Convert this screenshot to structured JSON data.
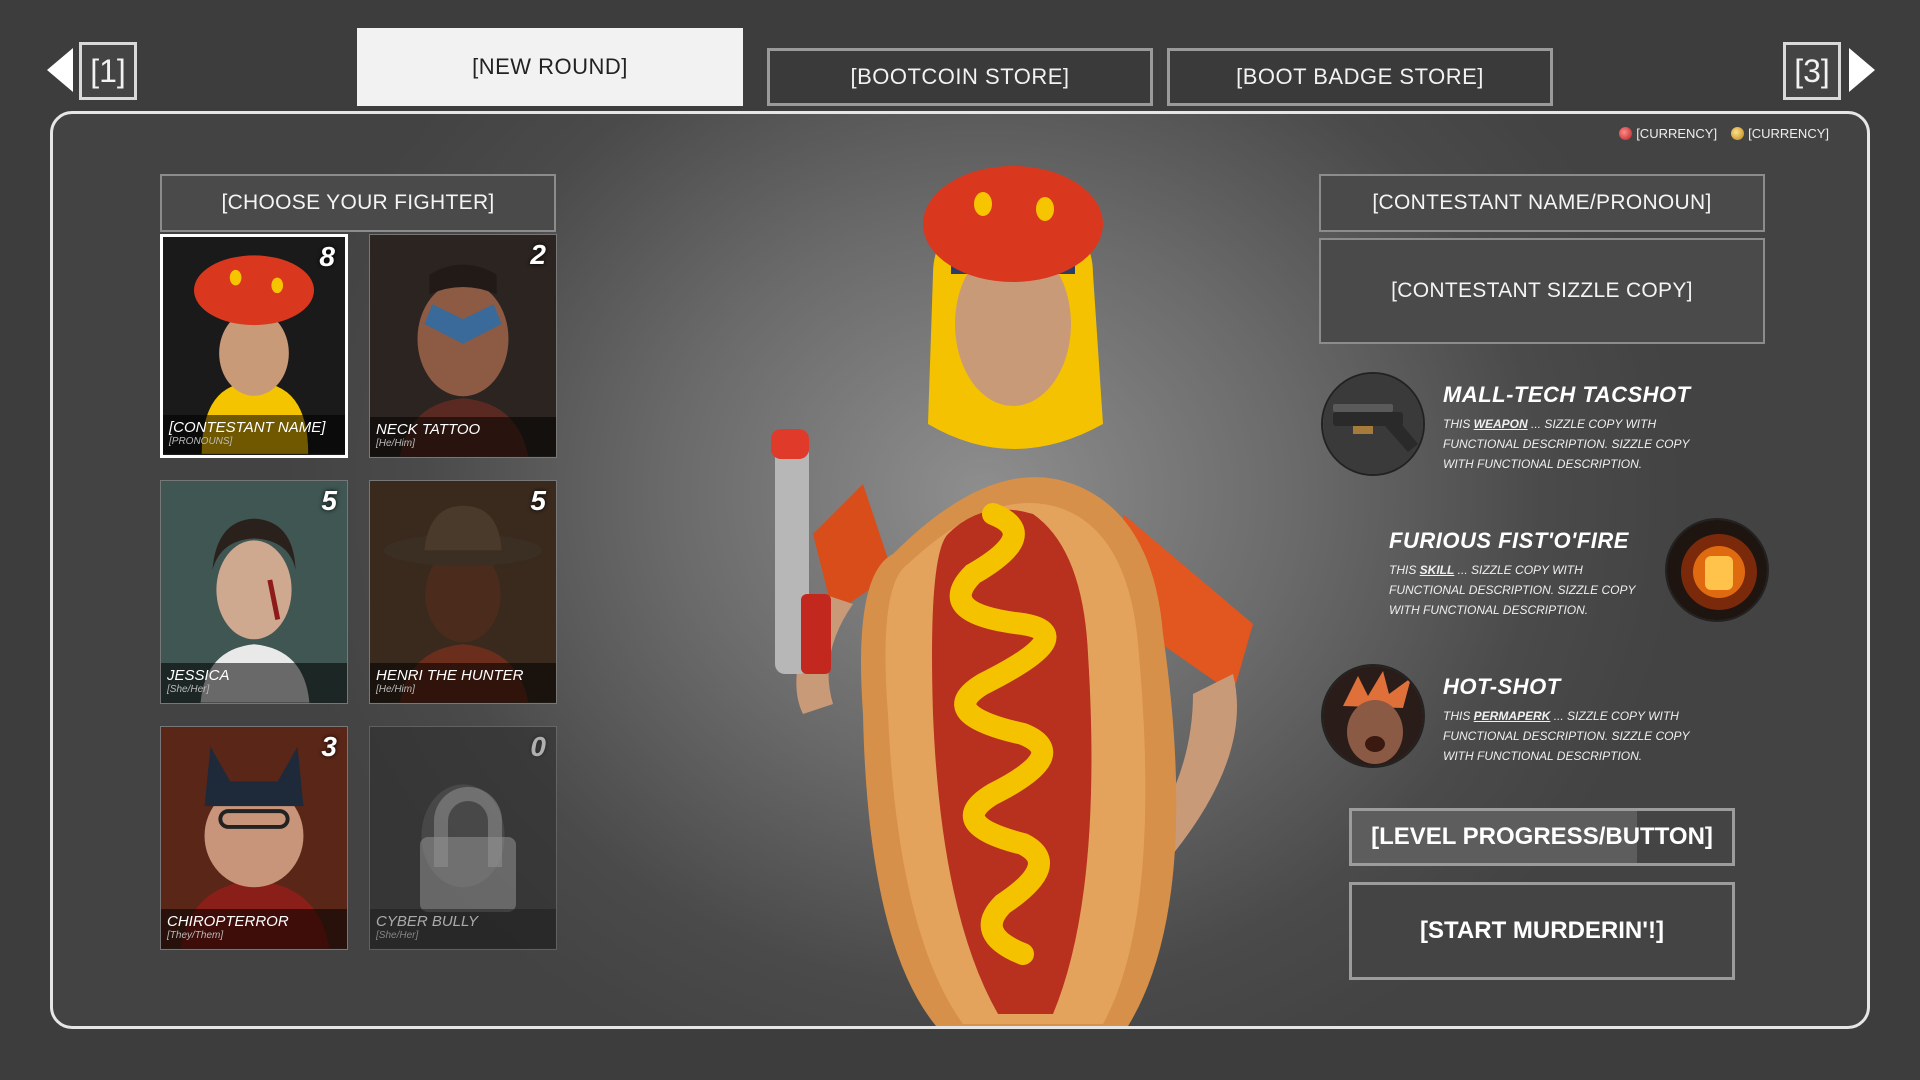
{
  "nav": {
    "prev_page": "[1]",
    "next_page": "[3]",
    "tabs": [
      {
        "label": "[NEW ROUND]",
        "active": true
      },
      {
        "label": "[BOOTCOIN STORE]",
        "active": false
      },
      {
        "label": "[BOOT BADGE STORE]",
        "active": false
      }
    ]
  },
  "currencies": [
    {
      "label": "[CURRENCY]",
      "color": "#c0392b"
    },
    {
      "label": "[CURRENCY]",
      "color": "#d4a020"
    }
  ],
  "choose_label": "[CHOOSE YOUR FIGHTER]",
  "fighters": [
    {
      "name": "[CONTESTANT NAME]",
      "pronouns": "[PRONOUNS]",
      "count": "8",
      "selected": true,
      "locked": false
    },
    {
      "name": "NECK TATTOO",
      "pronouns": "[He/Him]",
      "count": "2",
      "selected": false,
      "locked": false
    },
    {
      "name": "JESSICA",
      "pronouns": "[She/Her]",
      "count": "5",
      "selected": false,
      "locked": false
    },
    {
      "name": "HENRI THE HUNTER",
      "pronouns": "[He/Him]",
      "count": "5",
      "selected": false,
      "locked": false
    },
    {
      "name": "CHIROPTERROR",
      "pronouns": "[They/Them]",
      "count": "3",
      "selected": false,
      "locked": false
    },
    {
      "name": "CYBER BULLY",
      "pronouns": "[She/Her]",
      "count": "0",
      "selected": false,
      "locked": true
    }
  ],
  "contestant": {
    "name_pronoun": "[CONTESTANT NAME/PRONOUN]",
    "sizzle": "[CONTESTANT SIZZLE COPY]"
  },
  "abilities": [
    {
      "title": "MALL-TECH TACSHOT",
      "pre": "THIS ",
      "keyword": "WEAPON",
      "desc": " ... SIZZLE COPY WITH FUNCTIONAL DESCRIPTION. SIZZLE COPY WITH FUNCTIONAL DESCRIPTION.",
      "icon": "shotgun-icon"
    },
    {
      "title": "FURIOUS FIST'O'FIRE",
      "pre": "THIS ",
      "keyword": "SKILL",
      "desc": " ... SIZZLE COPY WITH FUNCTIONAL DESCRIPTION. SIZZLE COPY WITH FUNCTIONAL DESCRIPTION.",
      "icon": "flaming-fist-icon"
    },
    {
      "title": "HOT-SHOT",
      "pre": "THIS ",
      "keyword": "PERMAPERK",
      "desc": " ... SIZZLE COPY WITH FUNCTIONAL DESCRIPTION. SIZZLE COPY WITH FUNCTIONAL DESCRIPTION.",
      "icon": "exploding-head-icon"
    }
  ],
  "level_button": "[LEVEL PROGRESS/BUTTON]",
  "level_progress": 0.75,
  "start_button": "[START MURDERIN'!]"
}
